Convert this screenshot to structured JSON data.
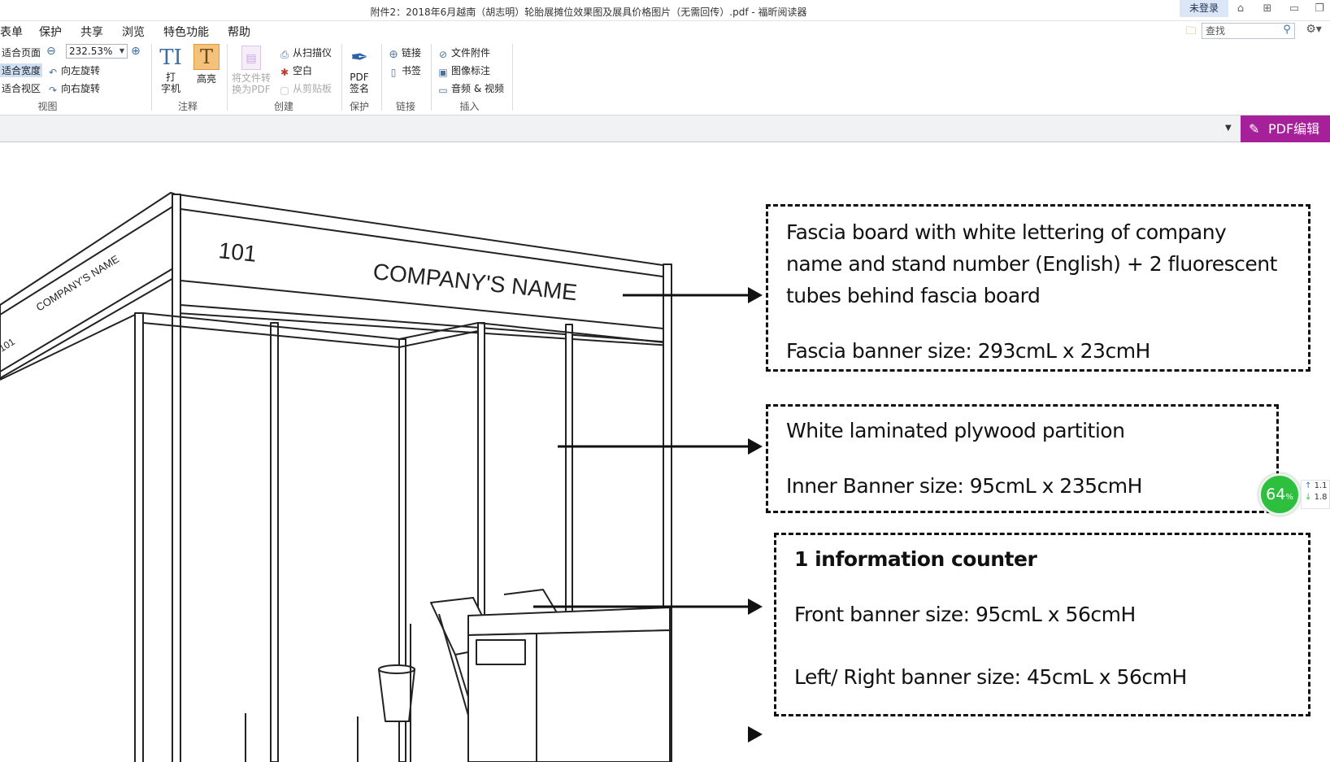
{
  "window": {
    "title": "附件2：2018年6月越南（胡志明）轮胎展摊位效果图及展具价格图片（无需回传）.pdf - 福昕阅读器",
    "login": "未登录"
  },
  "menu": [
    "表单",
    "保护",
    "共享",
    "浏览",
    "特色功能",
    "帮助"
  ],
  "search": {
    "placeholder": "查找"
  },
  "ribbon": {
    "view": {
      "fit_page": "适合页面",
      "fit_width": "适合宽度",
      "fit_visible": "适合视区",
      "zoom": "232.53%",
      "rotate_left": "向左旋转",
      "rotate_right": "向右旋转",
      "label": "视图"
    },
    "comment": {
      "typewriter_1": "打",
      "typewriter_2": "字机",
      "highlight": "高亮",
      "label": "注释"
    },
    "create": {
      "convert_1": "将文件转",
      "convert_2": "换为PDF",
      "from_scanner": "从扫描仪",
      "blank": "空白",
      "from_clipboard": "从剪贴板",
      "label": "创建"
    },
    "protect": {
      "sign_1": "PDF",
      "sign_2": "签名",
      "label": "保护"
    },
    "links": {
      "link": "链接",
      "bookmark": "书签",
      "label": "链接"
    },
    "insert": {
      "attachment": "文件附件",
      "image_annotation": "图像标注",
      "audio_video": "音频 & 视频",
      "label": "插入"
    }
  },
  "pdf_edit": "PDF编辑",
  "document": {
    "booth_number_front": "101",
    "booth_company_front": "COMPANY'S NAME",
    "booth_number_side": "101",
    "booth_company_side": "COMPANY'S NAME",
    "callout1": {
      "line1": "Fascia board with white lettering of company",
      "line2": "name and stand number (English) + 2 fluorescent",
      "line3": "tubes behind fascia board",
      "line4": "Fascia banner size: 293cmL x 23cmH"
    },
    "callout2": {
      "line1": "White laminated plywood partition",
      "line2": "Inner Banner size: 95cmL x 235cmH"
    },
    "callout3": {
      "line1": "1 information counter",
      "line2": "Front banner size: 95cmL x 56cmH",
      "line3": "Left/ Right banner size: 45cmL x 56cmH"
    }
  },
  "widget": {
    "percent": "64",
    "percent_sign": "%",
    "up": "1.1",
    "down": "1.8"
  }
}
